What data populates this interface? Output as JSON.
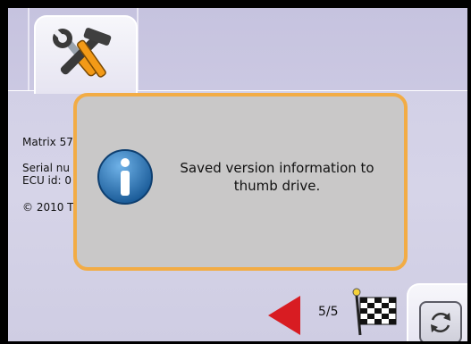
{
  "info": {
    "model": "Matrix 57",
    "serial": "Serial nu",
    "ecu": "ECU id: 0",
    "copyright": "© 2010 T"
  },
  "dialog": {
    "message": "Saved version information to\nthumb drive."
  },
  "nav": {
    "page_count": "5/5"
  },
  "icons": {
    "tab": "tools-icon",
    "dialog": "info-icon",
    "back": "back-arrow-icon",
    "finish": "checkered-flag-icon",
    "refresh": "refresh-icon"
  },
  "colors": {
    "dialog_border": "#f2ac45",
    "info_icon": "#2a6fae",
    "arrow": "#d81c22",
    "background": "#d4d2e8"
  }
}
